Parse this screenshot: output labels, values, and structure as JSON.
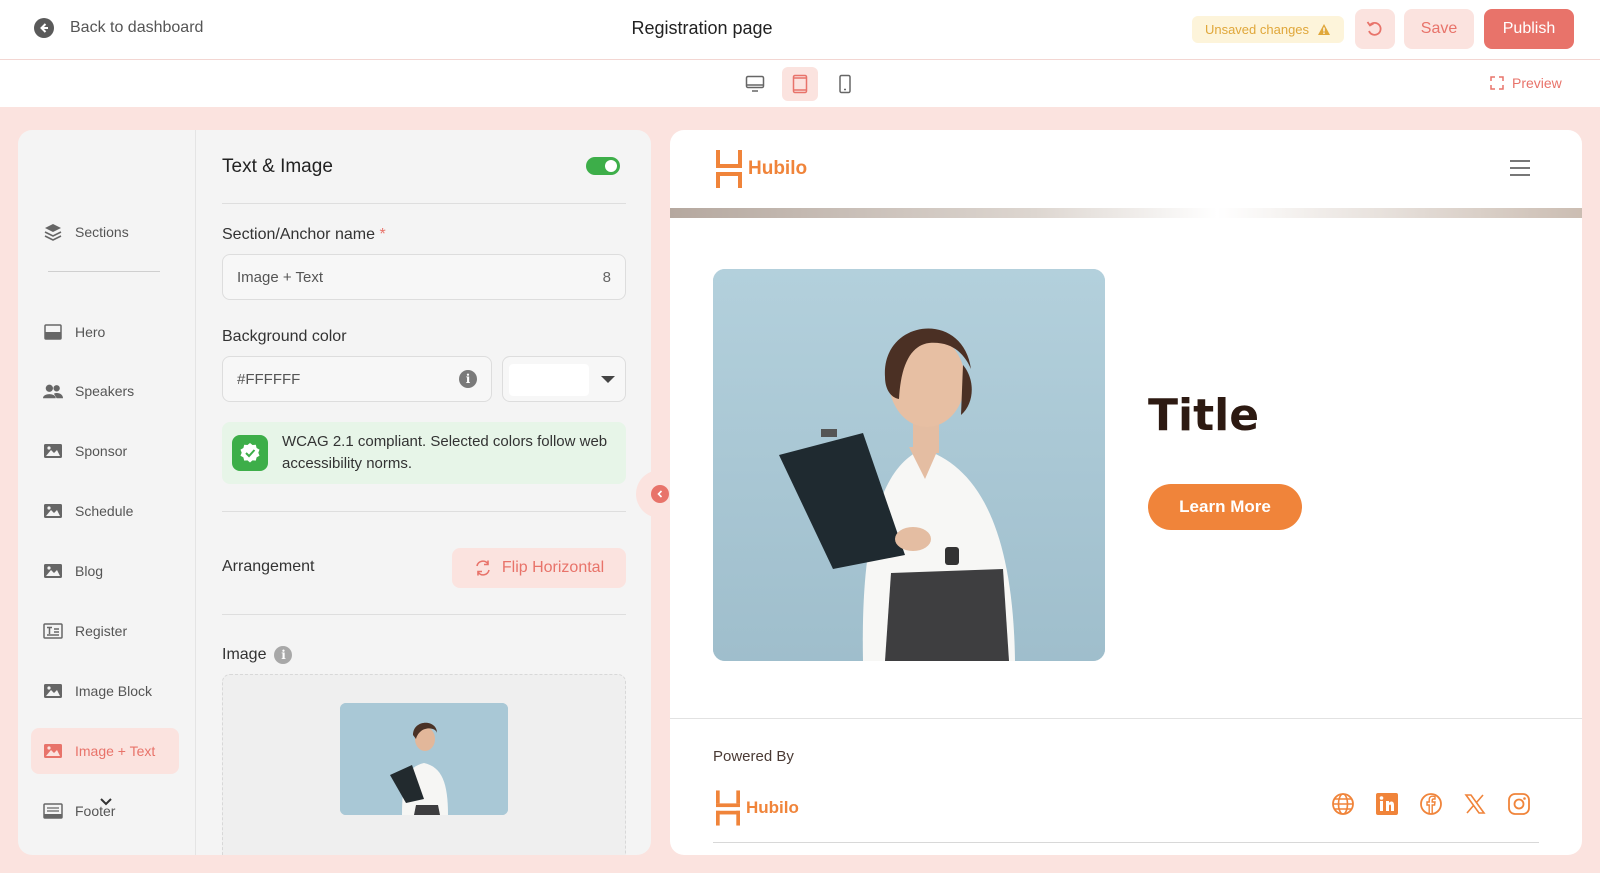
{
  "header": {
    "back_label": "Back to dashboard",
    "title": "Registration page",
    "unsaved_label": "Unsaved changes",
    "save_label": "Save",
    "publish_label": "Publish"
  },
  "devicebar": {
    "devices": [
      "desktop-icon",
      "tablet-icon",
      "mobile-icon"
    ],
    "active_device": "tablet",
    "preview_label": "Preview"
  },
  "sidebar": {
    "items": [
      {
        "label": "Sections",
        "icon": "layers-icon"
      },
      {
        "label": "Hero",
        "icon": "hero-icon"
      },
      {
        "label": "Speakers",
        "icon": "users-icon"
      },
      {
        "label": "Sponsor",
        "icon": "image-icon"
      },
      {
        "label": "Schedule",
        "icon": "image-icon"
      },
      {
        "label": "Blog",
        "icon": "image-icon"
      },
      {
        "label": "Register",
        "icon": "register-icon"
      },
      {
        "label": "Image Block",
        "icon": "image-icon"
      },
      {
        "label": "Image + Text",
        "icon": "image-icon",
        "active": true
      },
      {
        "label": "Footer",
        "icon": "footer-icon"
      }
    ]
  },
  "form": {
    "title": "Text & Image",
    "enabled": true,
    "anchor_label": "Section/Anchor name",
    "required_mark": "*",
    "anchor_value": "Image + Text",
    "anchor_counter": "8",
    "bg_label": "Background color",
    "bg_value": "#FFFFFF",
    "info_glyph": "i",
    "wcag_text": "WCAG 2.1 compliant. Selected colors follow web accessibility norms.",
    "arrangement_label": "Arrangement",
    "flip_label": "Flip Horizontal",
    "image_label": "Image"
  },
  "canvas": {
    "brand": "Hubilo",
    "hero_title": "Title",
    "cta_label": "Learn More",
    "powered_by": "Powered By",
    "footer_brand": "Hubilo",
    "socials": [
      "globe-icon",
      "linkedin-icon",
      "facebook-icon",
      "x-icon",
      "instagram-icon"
    ]
  },
  "colors": {
    "accent": "#e8736a",
    "brand_orange": "#f0843a",
    "workspace_bg": "#fbe3df",
    "success": "#3dae49",
    "warning": "#e0a73a"
  }
}
